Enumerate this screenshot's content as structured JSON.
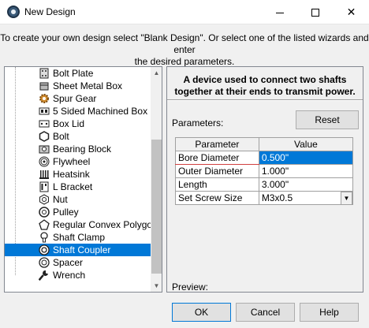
{
  "window": {
    "title": "New Design"
  },
  "instructions": [
    "To create your own design select \"Blank Design\". Or select one of the listed wizards and enter",
    "the desired parameters."
  ],
  "wizards": [
    {
      "label": "Bolt Plate",
      "icon": "bolt-plate-icon"
    },
    {
      "label": "Sheet Metal Box",
      "icon": "sheet-metal-box-icon"
    },
    {
      "label": "Spur Gear",
      "icon": "spur-gear-icon"
    },
    {
      "label": "5 Sided Machined Box",
      "icon": "machined-box-icon"
    },
    {
      "label": "Box Lid",
      "icon": "box-lid-icon"
    },
    {
      "label": "Bolt",
      "icon": "bolt-icon"
    },
    {
      "label": "Bearing Block",
      "icon": "bearing-block-icon"
    },
    {
      "label": "Flywheel",
      "icon": "flywheel-icon"
    },
    {
      "label": "Heatsink",
      "icon": "heatsink-icon"
    },
    {
      "label": "L Bracket",
      "icon": "l-bracket-icon"
    },
    {
      "label": "Nut",
      "icon": "nut-icon"
    },
    {
      "label": "Pulley",
      "icon": "pulley-icon"
    },
    {
      "label": "Regular Convex Polygon",
      "icon": "polygon-icon"
    },
    {
      "label": "Shaft Clamp",
      "icon": "shaft-clamp-icon"
    },
    {
      "label": "Shaft Coupler",
      "icon": "shaft-coupler-icon",
      "selected": true
    },
    {
      "label": "Spacer",
      "icon": "spacer-icon"
    },
    {
      "label": "Wrench",
      "icon": "wrench-icon"
    }
  ],
  "description": [
    "A device used to connect two shafts",
    "together at their ends to transmit power."
  ],
  "parameters_label": "Parameters:",
  "reset_label": "Reset",
  "grid": {
    "headers": [
      "Parameter",
      "Value"
    ],
    "rows": [
      {
        "name": "Bore Diameter",
        "value": "0.500\""
      },
      {
        "name": "Outer Diameter",
        "value": "1.000\""
      },
      {
        "name": "Length",
        "value": "3.000\""
      },
      {
        "name": "Set Screw Size",
        "value": "M3x0.5"
      }
    ]
  },
  "preview_label": "Preview:",
  "buttons": {
    "ok": "OK",
    "cancel": "Cancel",
    "help": "Help"
  },
  "colors": {
    "selection": "#0078d7"
  }
}
